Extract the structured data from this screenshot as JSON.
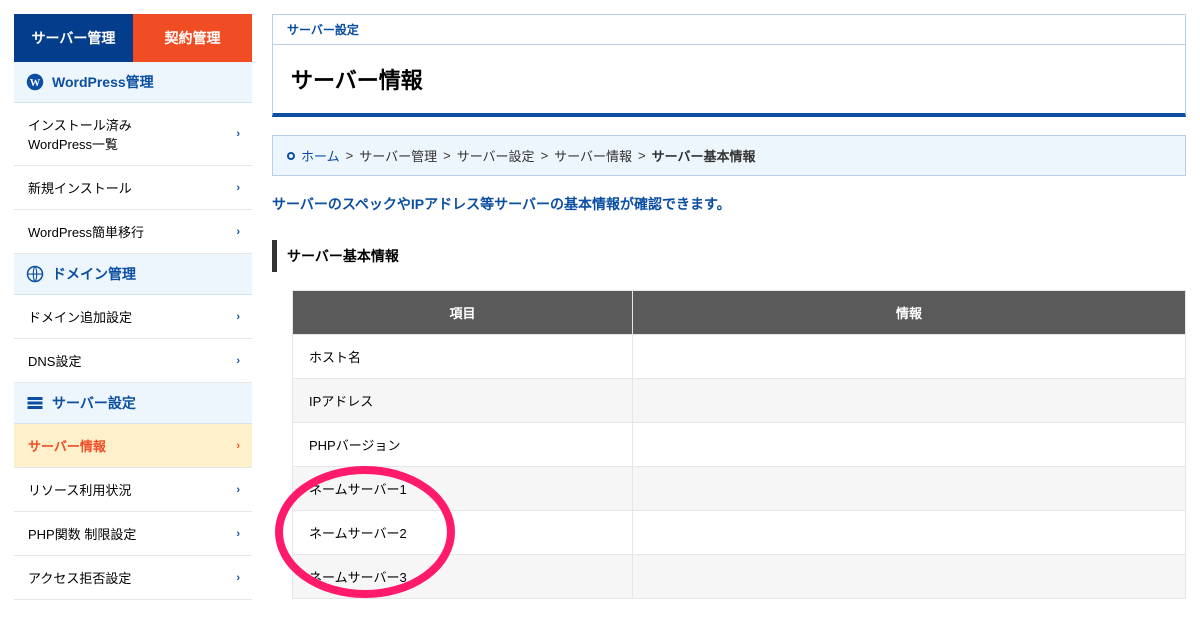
{
  "sidebar": {
    "tabs": {
      "active": "サーバー管理",
      "inactive": "契約管理"
    },
    "sections": [
      {
        "title": "WordPress管理",
        "items": [
          "インストール済み\nWordPress一覧",
          "新規インストール",
          "WordPress簡単移行"
        ]
      },
      {
        "title": "ドメイン管理",
        "items": [
          "ドメイン追加設定",
          "DNS設定"
        ]
      },
      {
        "title": "サーバー設定",
        "items": [
          "サーバー情報",
          "リソース利用状況",
          "PHP関数 制限設定",
          "アクセス拒否設定"
        ]
      }
    ],
    "active_item": "サーバー情報"
  },
  "page": {
    "head_label": "サーバー設定",
    "title": "サーバー情報",
    "lead": "サーバーのスペックやIPアドレス等サーバーの基本情報が確認できます。",
    "section_title": "サーバー基本情報"
  },
  "breadcrumb": {
    "home": "ホーム",
    "sep": ">",
    "items": [
      "サーバー管理",
      "サーバー設定",
      "サーバー情報"
    ],
    "current": "サーバー基本情報"
  },
  "table": {
    "head_key": "項目",
    "head_val": "情報",
    "rows": [
      {
        "key": "ホスト名",
        "val": ""
      },
      {
        "key": "IPアドレス",
        "val": ""
      },
      {
        "key": "PHPバージョン",
        "val": ""
      },
      {
        "key": "ネームサーバー1",
        "val": ""
      },
      {
        "key": "ネームサーバー2",
        "val": ""
      },
      {
        "key": "ネームサーバー3",
        "val": ""
      }
    ]
  }
}
